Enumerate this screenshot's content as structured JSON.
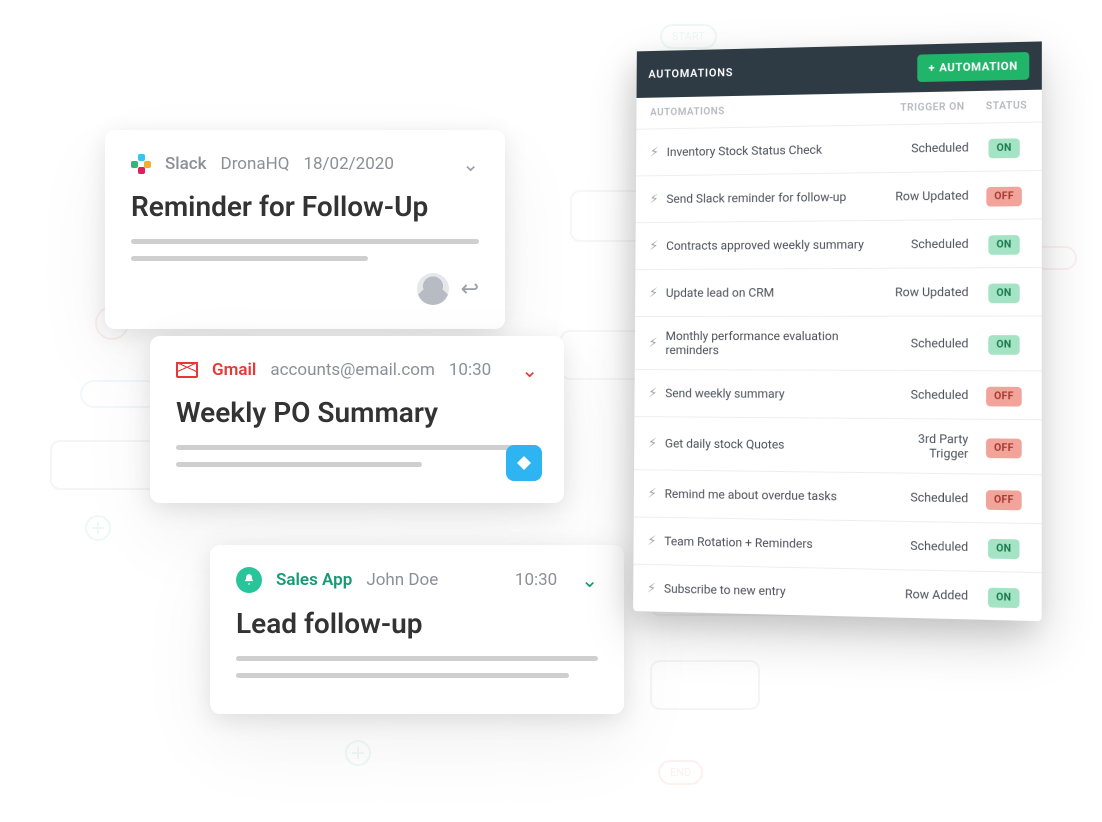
{
  "bg": {
    "start": "START",
    "end": "END"
  },
  "cards": {
    "slack": {
      "app": "Slack",
      "user": "DronaHQ",
      "date": "18/02/2020",
      "title": "Reminder for Follow-Up"
    },
    "gmail": {
      "app": "Gmail",
      "email": "accounts@email.com",
      "time": "10:30",
      "title": "Weekly PO Summary"
    },
    "sales": {
      "app": "Sales App",
      "user": "John Doe",
      "time": "10:30",
      "title": "Lead follow-up"
    }
  },
  "panel": {
    "header_title": "AUTOMATIONS",
    "button_label": "AUTOMATION",
    "th_name": "AUTOMATIONS",
    "th_trigger": "TRIGGER ON",
    "th_status": "STATUS",
    "rows": [
      {
        "name": "Inventory Stock Status Check",
        "trigger": "Scheduled",
        "status": "ON"
      },
      {
        "name": "Send Slack reminder for follow-up",
        "trigger": "Row Updated",
        "status": "OFF"
      },
      {
        "name": "Contracts approved weekly summary",
        "trigger": "Scheduled",
        "status": "ON"
      },
      {
        "name": "Update lead on CRM",
        "trigger": "Row Updated",
        "status": "ON"
      },
      {
        "name": "Monthly performance evaluation reminders",
        "trigger": "Scheduled",
        "status": "ON"
      },
      {
        "name": "Send weekly summary",
        "trigger": "Scheduled",
        "status": "OFF"
      },
      {
        "name": "Get daily stock Quotes",
        "trigger": "3rd Party Trigger",
        "status": "OFF"
      },
      {
        "name": "Remind me about overdue tasks",
        "trigger": "Scheduled",
        "status": "OFF"
      },
      {
        "name": "Team Rotation + Reminders",
        "trigger": "Scheduled",
        "status": "ON"
      },
      {
        "name": "Subscribe to new entry",
        "trigger": "Row Added",
        "status": "ON"
      }
    ]
  }
}
